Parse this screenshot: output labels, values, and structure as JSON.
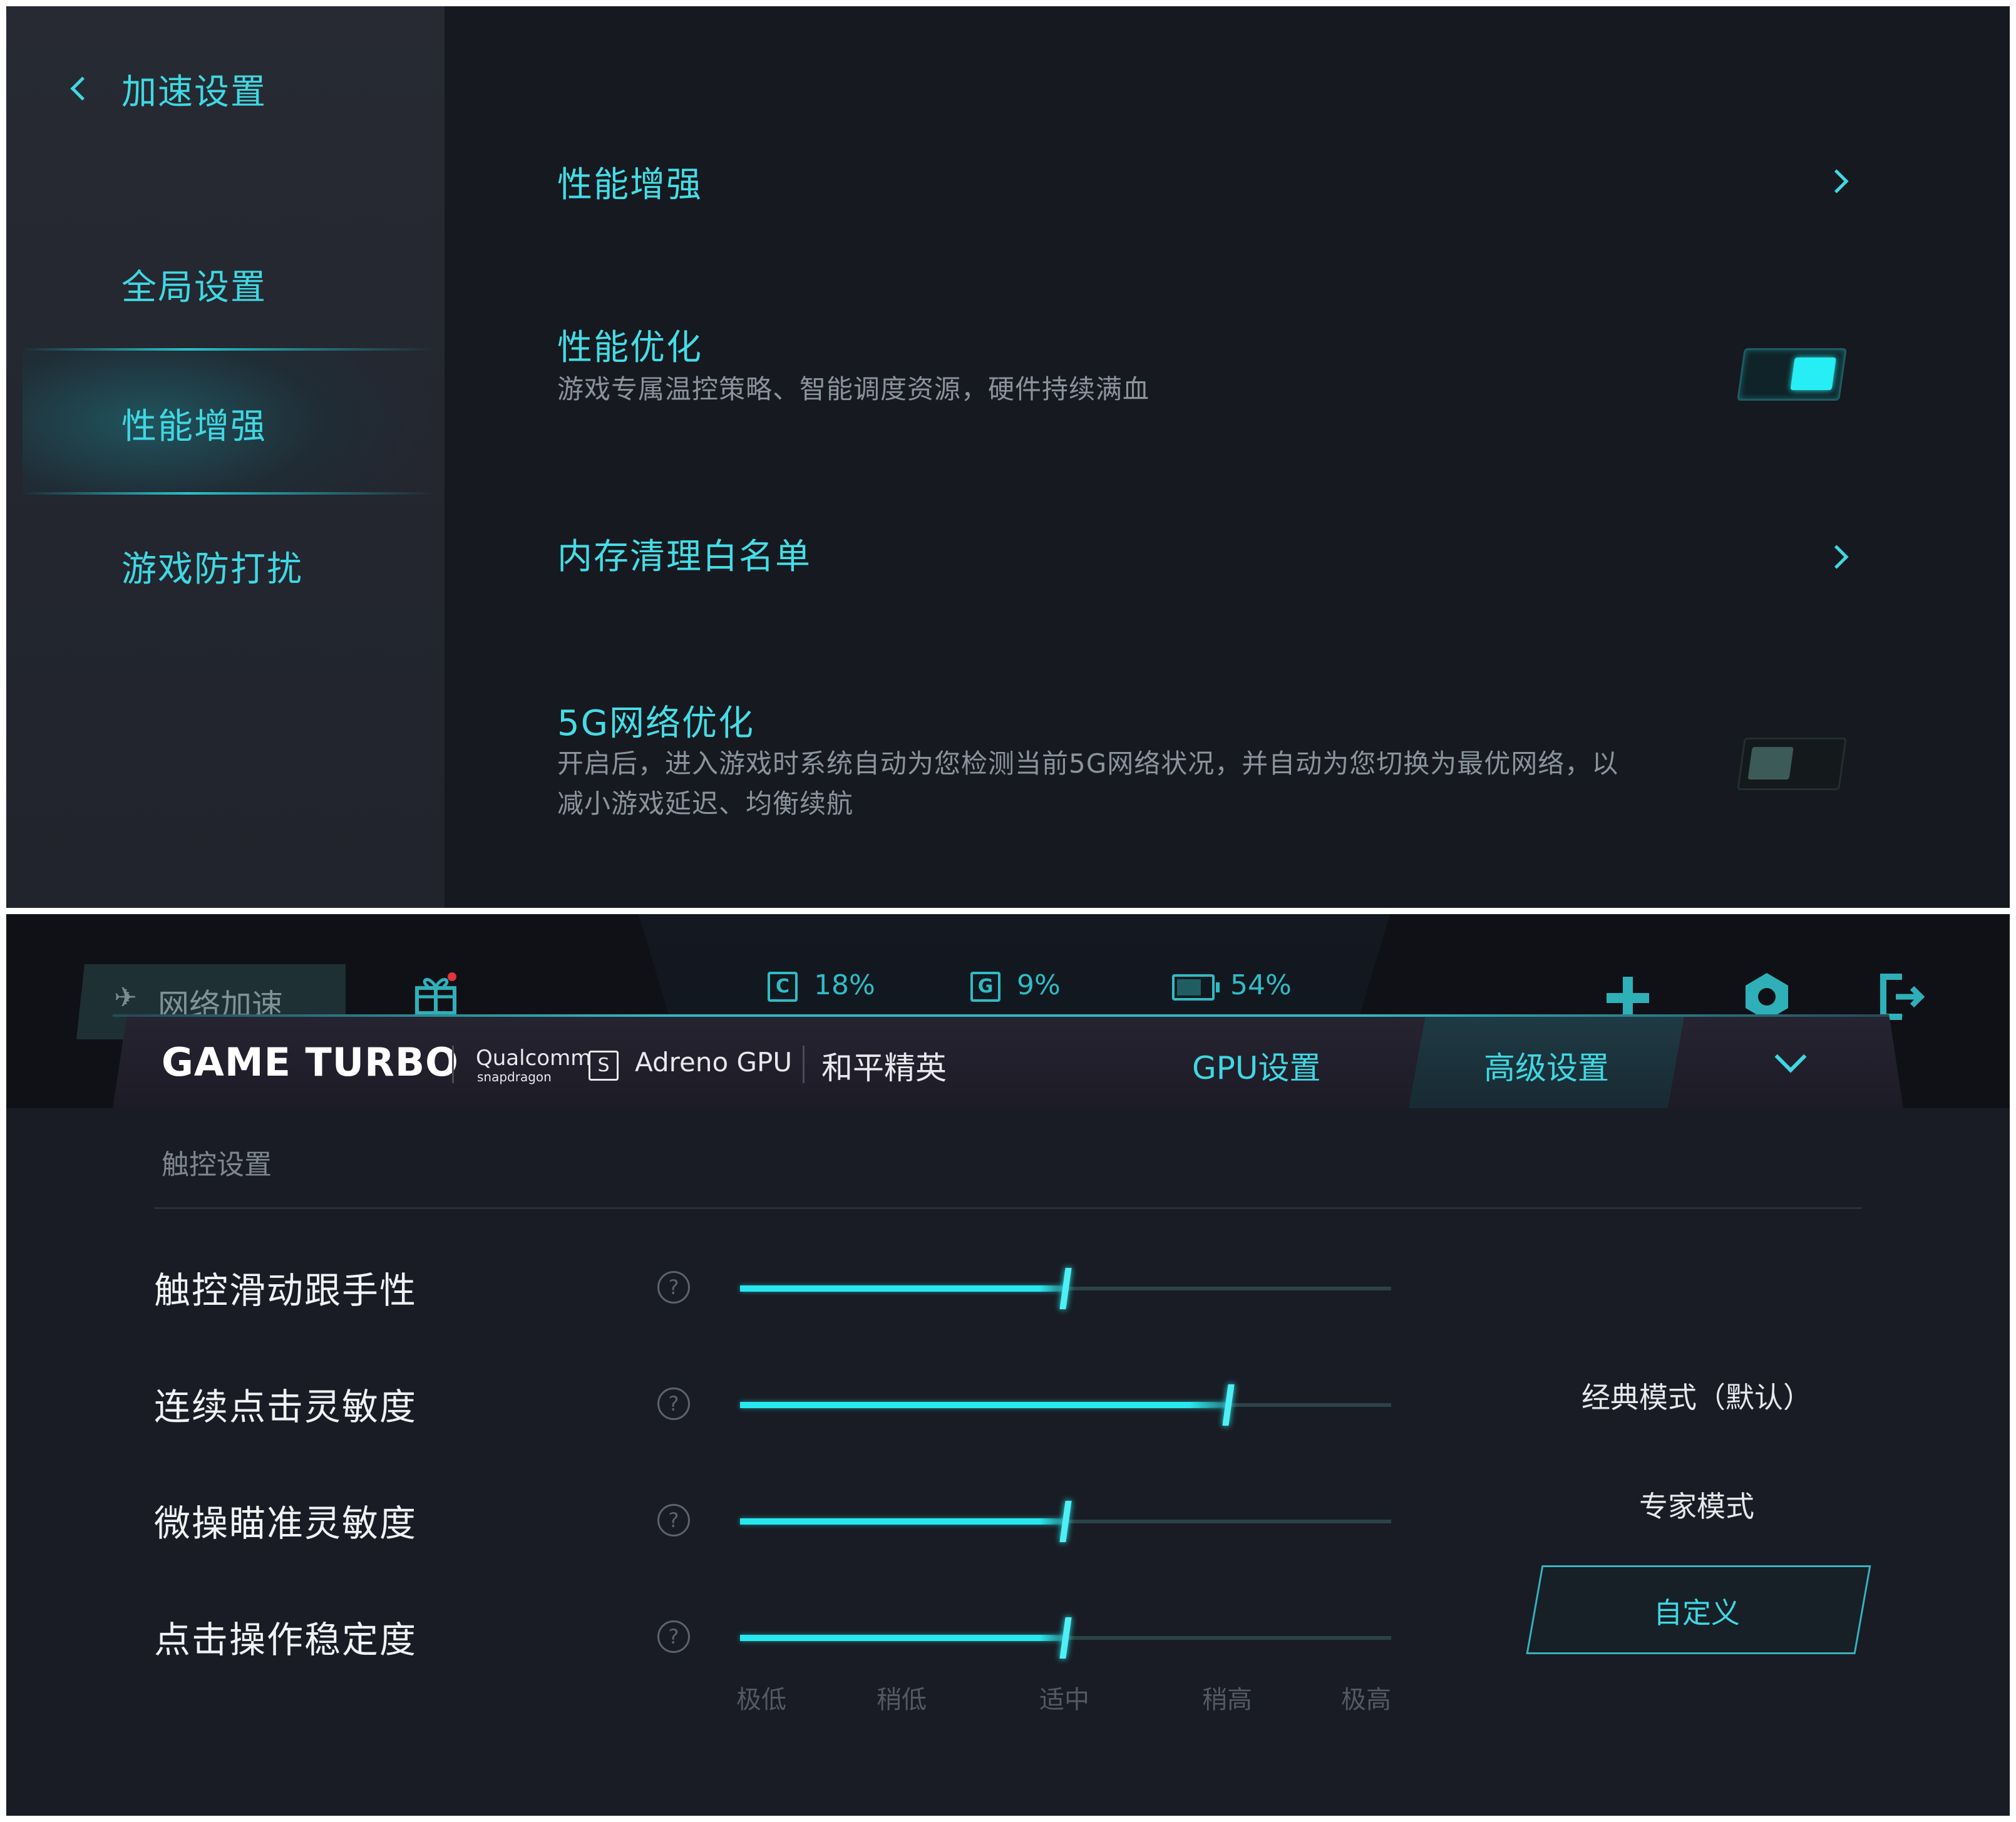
{
  "top": {
    "back_label": "加速设置",
    "sidebar": [
      {
        "label": "全局设置"
      },
      {
        "label": "性能增强",
        "active": true
      },
      {
        "label": "游戏防打扰"
      }
    ],
    "rows": [
      {
        "title": "性能增强",
        "type": "link"
      },
      {
        "title": "性能优化",
        "desc": "游戏专属温控策略、智能调度资源，硬件持续满血",
        "type": "toggle",
        "on": true
      },
      {
        "title": "内存清理白名单",
        "type": "link"
      },
      {
        "title": "5G网络优化",
        "desc_line1": "开启后，进入游戏时系统自动为您检测当前5G网络状况，并自动为您切换为最优网络，以",
        "desc_line2": "减小游戏延迟、均衡续航",
        "type": "toggle",
        "on": false
      }
    ]
  },
  "bottom": {
    "net_tab": "网络加速",
    "stats": {
      "cpu_icon": "C",
      "cpu": "18%",
      "gpu_icon": "G",
      "gpu": "9%",
      "battery": "54%"
    },
    "header": {
      "brand": "GAME TURBO",
      "qualcomm": "Qualcomm",
      "snapdragon": "snapdragon",
      "gpu_name": "Adreno GPU",
      "game": "和平精英",
      "tab_gpu": "GPU设置",
      "tab_advanced": "高级设置"
    },
    "section": "触控设置",
    "settings": [
      {
        "label": "触控滑动跟手性",
        "level": 0.5
      },
      {
        "label": "连续点击灵敏度",
        "level": 0.75
      },
      {
        "label": "微操瞄准灵敏度",
        "level": 0.5
      },
      {
        "label": "点击操作稳定度",
        "level": 0.5
      }
    ],
    "scale_labels": [
      "极低",
      "稍低",
      "适中",
      "稍高",
      "极高"
    ],
    "modes": {
      "classic": "经典模式（默认）",
      "expert": "专家模式",
      "custom": "自定义"
    },
    "help_glyph": "?"
  },
  "colors": {
    "accent": "#3fe0e8",
    "panel_bg": "#16191f",
    "sidebar_bg": "#262932"
  }
}
